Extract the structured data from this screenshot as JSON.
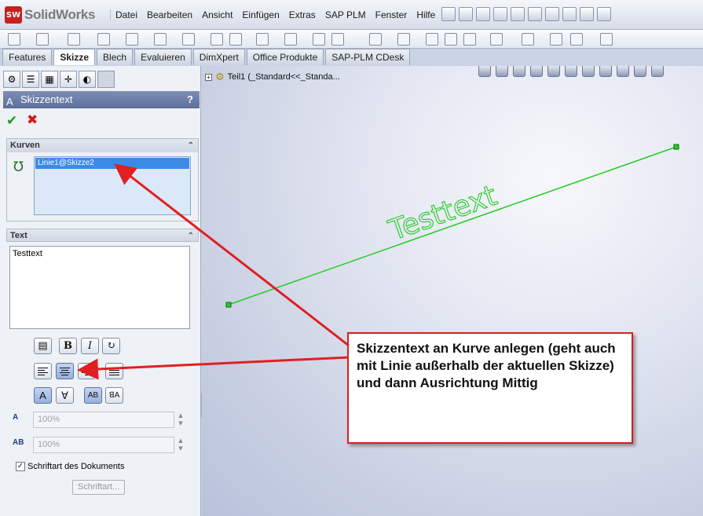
{
  "app": {
    "logo_text": "SolidWorks",
    "logo_badge": "SW"
  },
  "menu": [
    "Datei",
    "Bearbeiten",
    "Ansicht",
    "Einfügen",
    "Extras",
    "SAP PLM",
    "Fenster",
    "Hilfe"
  ],
  "tabs": [
    "Features",
    "Skizze",
    "Blech",
    "Evaluieren",
    "DimXpert",
    "Office Produkte",
    "SAP-PLM CDesk"
  ],
  "active_tab": "Skizze",
  "property_manager": {
    "title": "Skizzentext",
    "help": "?",
    "ok_symbol": "✔",
    "cancel_symbol": "✖",
    "curves": {
      "header": "Kurven",
      "items": [
        "Linie1@Skizze2"
      ]
    },
    "text": {
      "header": "Text",
      "value": "Testtext"
    },
    "format_buttons": {
      "bold": "B",
      "italic": "I"
    },
    "width_value": "100%",
    "spacing_value": "100%",
    "width_icon": "A",
    "spacing_icon": "AB",
    "doc_font_label": "Schriftart des Dokuments",
    "doc_font_checked": "✓",
    "font_button": "Schriftart..."
  },
  "tree": {
    "expand": "+",
    "label": "Teil1  (_Standard<<_Standa..."
  },
  "sketch": {
    "text": "Testtext",
    "color": "#22cc22"
  },
  "callout": {
    "text": "Skizzentext an Kurve anlegen (geht auch mit Linie außerhalb der aktuellen Skizze) und dann Ausrichtung Mittig",
    "border_color": "#d42020"
  },
  "colors": {
    "accent": "#5c6f9b",
    "selection": "#3b8ae6",
    "arrow": "#e02020"
  }
}
